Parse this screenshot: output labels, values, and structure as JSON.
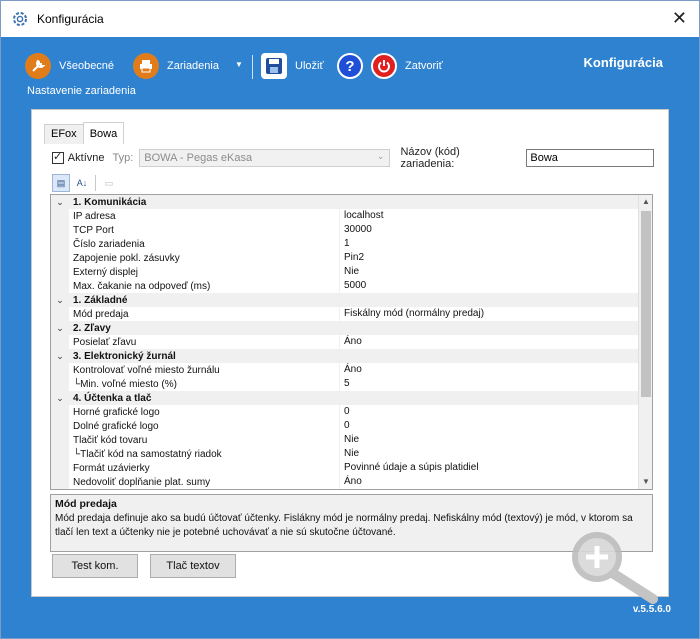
{
  "window": {
    "title": "Konfigurácia",
    "close_glyph": "✕"
  },
  "toolbar": {
    "general_label": "Všeobecné",
    "devices_label": "Zariadenia",
    "save_label": "Uložiť",
    "help_glyph": "?",
    "close_label": "Zatvoriť",
    "subtitle": "Nastavenie zariadenia",
    "brand": "Konfigurácia",
    "colors": {
      "general": "#e07d1a",
      "devices": "#e07d1a",
      "save": "#1f4f9a",
      "help": "#1f4fd6",
      "close": "#e02020"
    }
  },
  "tabs": [
    {
      "label": "EFox"
    },
    {
      "label": "Bowa"
    }
  ],
  "form": {
    "active_label": "Aktívne",
    "type_label": "Typ:",
    "type_value": "BOWA - Pegas eKasa",
    "name_label": "Názov (kód) zariadenia:",
    "name_value": "Bowa"
  },
  "grid": {
    "rows": [
      {
        "kind": "cat",
        "label": "1. Komunikácia"
      },
      {
        "kind": "prop",
        "name": "IP adresa",
        "value": "localhost"
      },
      {
        "kind": "prop",
        "name": "TCP Port",
        "value": "30000"
      },
      {
        "kind": "prop",
        "name": "Číslo zariadenia",
        "value": "1"
      },
      {
        "kind": "prop",
        "name": "Zapojenie pokl. zásuvky",
        "value": "Pin2"
      },
      {
        "kind": "prop",
        "name": "Externý displej",
        "value": "Nie"
      },
      {
        "kind": "prop",
        "name": "Max. čakanie na odpoveď (ms)",
        "value": "5000"
      },
      {
        "kind": "cat",
        "label": "1. Základné"
      },
      {
        "kind": "prop",
        "name": "Mód predaja",
        "value": "Fiskálny mód (normálny predaj)"
      },
      {
        "kind": "cat",
        "label": "2. Zľavy"
      },
      {
        "kind": "prop",
        "name": "Posielať zľavu",
        "value": "Áno"
      },
      {
        "kind": "cat",
        "label": "3. Elektronický žurnál"
      },
      {
        "kind": "prop",
        "name": "Kontrolovať voľné miesto žurnálu",
        "value": "Áno"
      },
      {
        "kind": "prop",
        "name": "└Min. voľné miesto (%)",
        "value": "5"
      },
      {
        "kind": "cat",
        "label": "4. Účtenka a tlač"
      },
      {
        "kind": "prop",
        "name": "Horné grafické logo",
        "value": "0"
      },
      {
        "kind": "prop",
        "name": "Dolné grafické logo",
        "value": "0"
      },
      {
        "kind": "prop",
        "name": "Tlačiť kód tovaru",
        "value": "Nie"
      },
      {
        "kind": "prop",
        "name": "└Tlačiť kód na samostatný riadok",
        "value": "Nie"
      },
      {
        "kind": "prop",
        "name": "Formát uzávierky",
        "value": "Povinné údaje a súpis platidiel"
      },
      {
        "kind": "prop",
        "name": "Nedovoliť doplňanie plat. sumy",
        "value": "Áno"
      }
    ]
  },
  "help": {
    "title": "Mód predaja",
    "text": "Mód predaja definuje ako sa budú účtovať účtenky. Fislákny mód je normálny predaj. Nefiskálny mód (textový) je mód, v ktorom sa tlačí len text a účtenky nie je potebné uchovávať a nie sú skutočne účtované."
  },
  "buttons": {
    "test_label": "Test kom.",
    "print_label": "Tlač textov"
  },
  "version": "v.5.5.6.0"
}
